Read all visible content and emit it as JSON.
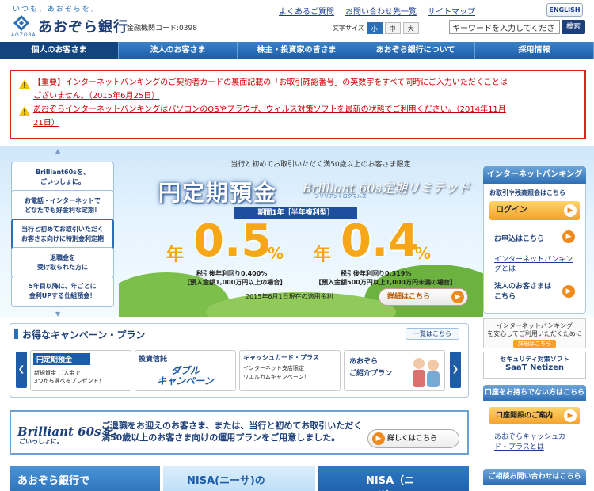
{
  "header": {
    "tagline": "いつも、あおぞらを。",
    "logo_sub": "AOZORA",
    "bank_name": "あおぞら銀行",
    "fin_code": "金融機関コード:0398",
    "links": [
      "よくあるご質問",
      "お問い合わせ先一覧",
      "サイトマップ"
    ],
    "english": "ENGLISH",
    "font_size_label": "文字サイズ",
    "font_sizes": [
      "小",
      "中",
      "大"
    ],
    "search_placeholder": "キーワードを入力してくださ",
    "search_button": "検索"
  },
  "nav": [
    "個人のお客さま",
    "法人のお客さま",
    "株主・投資家の皆さま",
    "あおぞら銀行について",
    "採用情報"
  ],
  "notices": [
    {
      "line1": "【重要】インターネットバンキングのご契約者カードの裏面記載の「お取引確認番号」の英数字をすべて同時にご入力いただくことは",
      "line2": "ございません。（2015年6月25日）"
    },
    {
      "line1": "あおぞらインターネットバンキングはパソコンのOSやブラウザ、ウィルス対策ソフトを最新の状態でご利用ください。（2014年11月",
      "line2": "21日）"
    }
  ],
  "side_list": [
    "Brilliant60sを、\nごいっしょに。",
    "お電話・インターネットで\nどなたでも好金利な定期！",
    "当行と初めてお取引いただく\nお客さま向けに特別金利定期",
    "退職金を\n受け取られた方に",
    "5年目以降に、年ごとに\n金利UPする仕組預金！"
  ],
  "hero": {
    "subtitle": "当行と初めてお取引いただく満50歳以上のお客さま限定",
    "title": "円定期預金",
    "brand": "Brilliant 60s定期リミテッド",
    "brand_sub": "ブリリアントロクマルズ",
    "term": "期間1年［半年複利型］",
    "nen": "年",
    "rate1": "0.5",
    "rate2": "0.4",
    "pct": "%",
    "note1a": "税引後年利回り0.400%",
    "note1b": "【預入金額1,000万円以上の場合】",
    "note2a": "税引後年利回り0.319%",
    "note2b": "【預入金額500万円以上1,000万円未満の場合】",
    "date": "2015年6月1日現在の適用金利",
    "detail": "詳細はこちら"
  },
  "right": {
    "ib_head": "インターネットバンキング",
    "ib_inquiry": "お取引や残高照会はこちら",
    "login": "ログイン",
    "apply": "お申込はこちら",
    "what_is": "インターネットバンキングとは",
    "corp": "法人のお客さまは\nこちら",
    "security": "インターネットバンキング\nを安心してご利用いただくために",
    "security_link": "詳細はこちら",
    "netzen_label": "セキュリティ対策ソフト",
    "netzen": "SaaT Netizen",
    "no_acct": "口座をお持ちでない方はこちら",
    "open_acct": "口座開設のご案内",
    "cashcard_link": "あおぞらキャッシュカード・プラスとは",
    "contact": "ご相談お問い合わせはこちら"
  },
  "campaign": {
    "title": "お得なキャンペーン・プラン",
    "all": "一覧はこちら",
    "cards": [
      {
        "title": "円定期預金",
        "body": "新規資金 ご入金で\n3つから選べるプレゼント！"
      },
      {
        "title": "投資信託",
        "body": "ダブル\nキャンペーン"
      },
      {
        "title": "キャッシュカード・プラス",
        "body": "インターネット支店限定\nウエルカムキャンペーン！"
      },
      {
        "title": "あおぞら",
        "body": "ご紹介プラン"
      }
    ]
  },
  "brilliant": {
    "logo": "Brilliant 60sを、",
    "logo_sub": "ごいっしょに。",
    "text": "ご退職をお迎えのお客さま、または、当行と初めてお取引いただく満50歳以上のお客さま向けの運用プランをご用意しました。",
    "button": "詳しくはこちら"
  },
  "bottom": [
    "あおぞら銀行で",
    "NISA(ニーサ)の",
    "NISA（ニーサ）"
  ]
}
